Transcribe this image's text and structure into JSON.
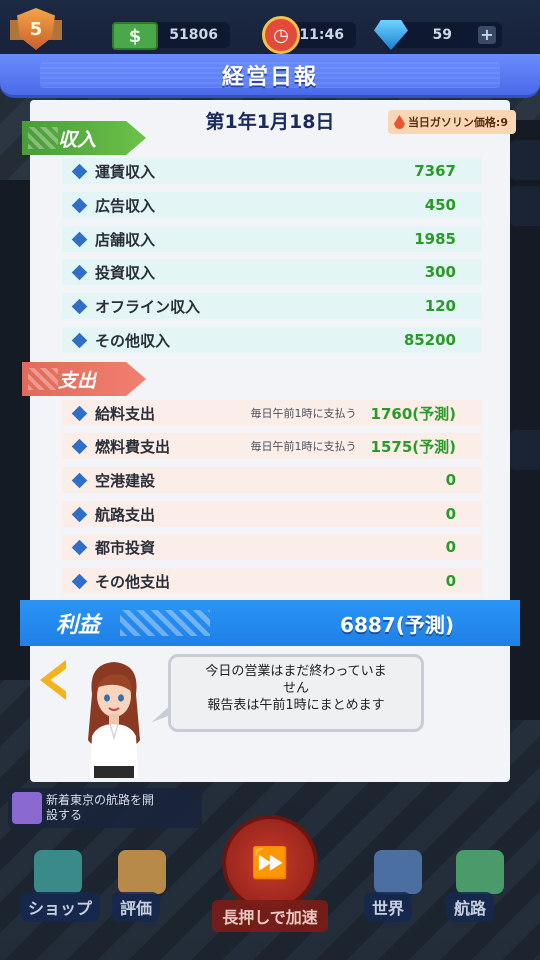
{
  "hud": {
    "level": "5",
    "cash_symbol": "$",
    "cash": "51806",
    "time": "11:46",
    "gems": "59",
    "plus": "+"
  },
  "dialog": {
    "title": "経営日報",
    "date": "第1年1月18日",
    "gas_price_label": "当日ガソリン価格:9"
  },
  "income": {
    "tag": "収入",
    "rows": [
      {
        "label": "運賃収入",
        "value": "7367"
      },
      {
        "label": "広告収入",
        "value": "450"
      },
      {
        "label": "店舗収入",
        "value": "1985"
      },
      {
        "label": "投資収入",
        "value": "300"
      },
      {
        "label": "オフライン収入",
        "value": "120"
      },
      {
        "label": "その他収入",
        "value": "85200"
      }
    ]
  },
  "expense": {
    "tag": "支出",
    "rows": [
      {
        "label": "給料支出",
        "note": "毎日午前1時に支払う",
        "value": "1760(予測)"
      },
      {
        "label": "燃料費支出",
        "note": "毎日午前1時に支払う",
        "value": "1575(予測)"
      },
      {
        "label": "空港建設",
        "note": "",
        "value": "0"
      },
      {
        "label": "航路支出",
        "note": "",
        "value": "0"
      },
      {
        "label": "都市投資",
        "note": "",
        "value": "0"
      },
      {
        "label": "その他支出",
        "note": "",
        "value": "0"
      }
    ]
  },
  "profit": {
    "label": "利益",
    "value": "6887(予測)"
  },
  "speech": {
    "line1": "今日の営業はまだ終わっていま",
    "line2": "せん",
    "line3": "報告表は午前1時にまとめます"
  },
  "mission": {
    "text_line1": "新着東京の航路を開",
    "text_line2": "設する"
  },
  "nav": {
    "shop": "ショップ",
    "rating": "評価",
    "speed": "長押しで加速",
    "world": "世界",
    "routes": "航路"
  },
  "colors": {
    "header": "#5a7cf5",
    "income_tag": "#5aae42",
    "expense_tag": "#ea7565",
    "profit_bar": "#2389ee",
    "positive_value": "#2a9a2a"
  }
}
